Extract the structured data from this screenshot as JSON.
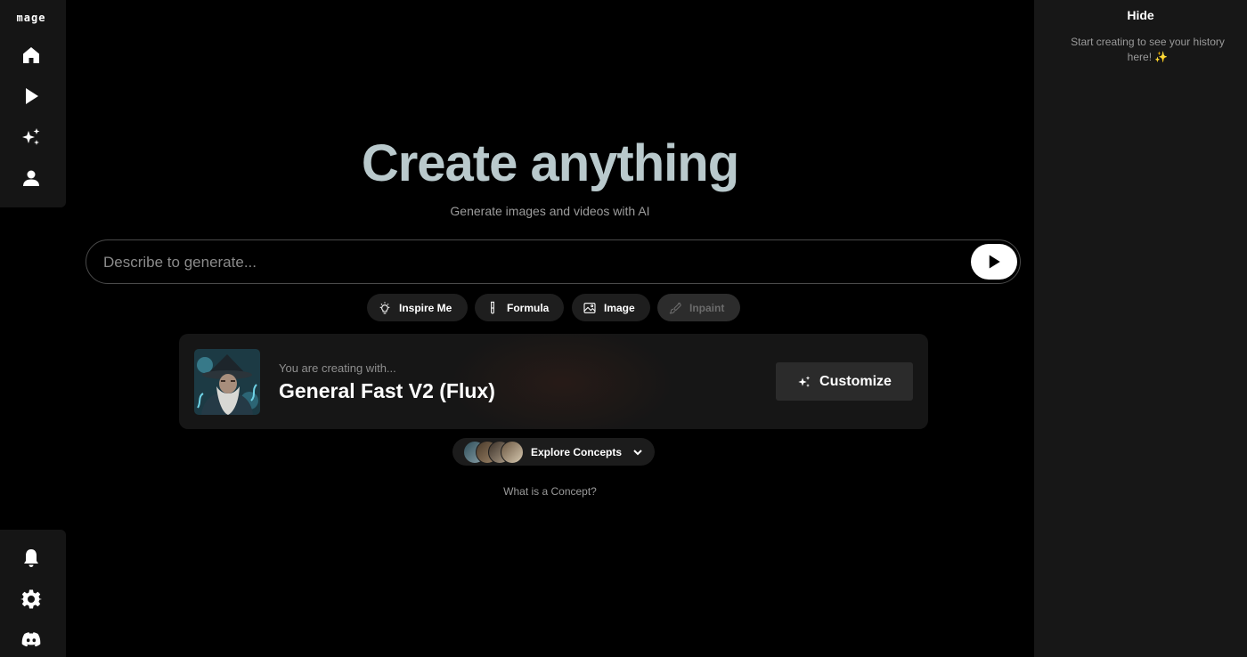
{
  "app": {
    "logo_text": "mage"
  },
  "sidebar": {
    "top_icons": [
      "home-icon",
      "play-icon",
      "sparkles-icon",
      "user-icon"
    ],
    "bottom_icons": [
      "bell-icon",
      "gear-icon",
      "discord-icon"
    ]
  },
  "history": {
    "hide_label": "Hide",
    "empty_text": "Start creating to see your history here! ✨"
  },
  "hero": {
    "title": "Create anything",
    "subtitle": "Generate images and videos with AI"
  },
  "prompt": {
    "placeholder": "Describe to generate..."
  },
  "chips": [
    {
      "label": "Inspire Me",
      "icon": "lightbulb-icon",
      "enabled": true
    },
    {
      "label": "Formula",
      "icon": "test-tube-icon",
      "enabled": true
    },
    {
      "label": "Image",
      "icon": "image-icon",
      "enabled": true
    },
    {
      "label": "Inpaint",
      "icon": "brush-icon",
      "enabled": false
    }
  ],
  "model": {
    "intro": "You are creating with...",
    "name": "General Fast V2 (Flux)",
    "customize_label": "Customize"
  },
  "explore": {
    "label": "Explore Concepts"
  },
  "concept_link": "What is a Concept?"
}
